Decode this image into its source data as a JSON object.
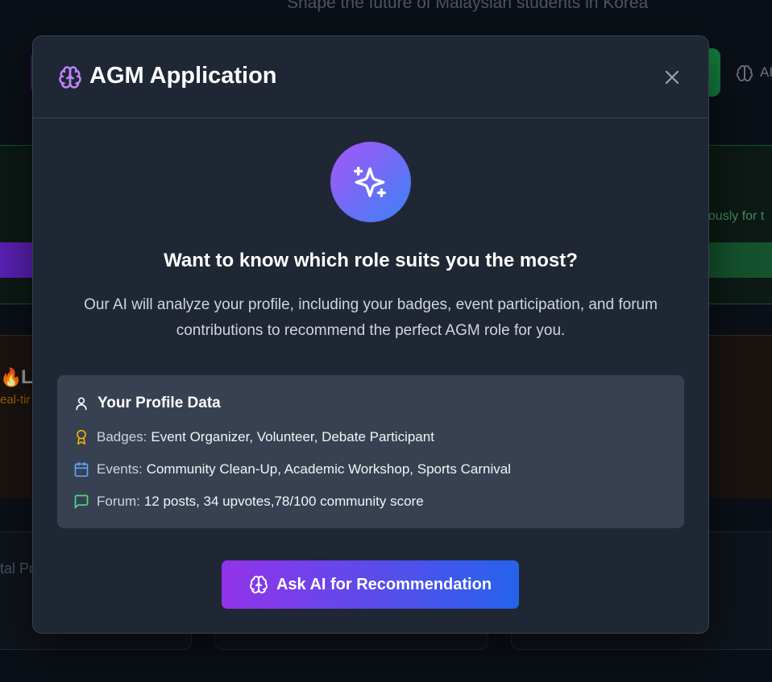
{
  "background": {
    "subtitle": "Shape the future of Malaysian students in Korea",
    "ai_button_fragment": "AI",
    "announcement_fragment": "eously for t",
    "live_title_fragment": "L",
    "live_subtitle_fragment": "eal-tir",
    "stat_fragment": "tal Po"
  },
  "modal": {
    "title": "AGM Application",
    "title_icon": "brain-icon",
    "close_icon": "close-icon",
    "hero_icon": "sparkles-icon",
    "question": "Want to know which role suits you the most?",
    "description": "Our AI will analyze your profile, including your badges, event participation, and forum contributions to recommend the perfect AGM role for you.",
    "profile": {
      "title": "Your Profile Data",
      "icon": "user-icon",
      "rows": [
        {
          "icon": "award-icon",
          "label": "Badges:",
          "value": "Event Organizer, Volunteer, Debate Participant"
        },
        {
          "icon": "calendar-icon",
          "label": "Events:",
          "value": "Community Clean-Up, Academic Workshop, Sports Carnival"
        },
        {
          "icon": "message-icon",
          "label": "Forum:",
          "value": "12 posts, 34 upvotes,78/100 community score"
        }
      ]
    },
    "cta": {
      "label": "Ask AI for Recommendation",
      "icon": "brain-icon"
    }
  },
  "colors": {
    "accent_purple": "#a855f7",
    "accent_blue": "#3b82f6",
    "badge_yellow": "#eab308",
    "calendar_blue": "#60a5fa",
    "forum_green": "#4ade80"
  }
}
